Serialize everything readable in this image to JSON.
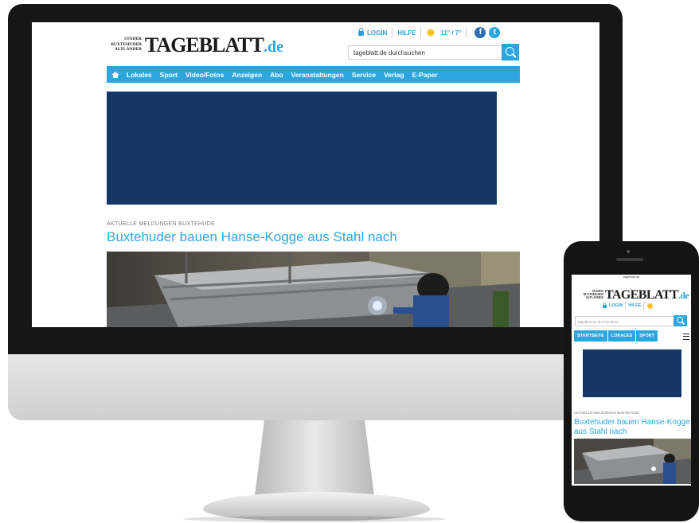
{
  "desktop": {
    "logo": {
      "small_lines": [
        "STADER",
        "BUXTEHUDER",
        "ALTLÄNDER"
      ],
      "main": "TAGEBLATT",
      "tld": ".de"
    },
    "top_links": {
      "login": "LOGIN",
      "help": "HILFE",
      "weather": "11° / 7°"
    },
    "search": {
      "placeholder": "tageblatt.de durchsuchen"
    },
    "nav": [
      "Lokales",
      "Sport",
      "Video/Fotos",
      "Anzeigen",
      "Abo",
      "Veranstaltungen",
      "Service",
      "Verlag",
      "E-Paper"
    ],
    "article": {
      "kicker": "AKTUELLE MELDUNGEN BUXTEHUDE",
      "headline": "Buxtehuder bauen Hanse-Kogge aus Stahl nach"
    }
  },
  "mobile": {
    "status_bar": "tageblatt.de",
    "logo": {
      "small_lines": [
        "STADER",
        "BUXTEHUDER",
        "ALTLÄNDER"
      ],
      "main": "TAGEBLATT",
      "tld": ".de"
    },
    "top_links": {
      "login": "LOGIN",
      "help": "HILFE"
    },
    "search": {
      "placeholder": "tageblatt.de durchsuchen"
    },
    "nav": [
      "STARTSEITE",
      "LOKALES",
      "SPORT"
    ],
    "article": {
      "kicker": "AKTUELLE MELDUNGEN BUXTEHUDE",
      "headline": "Buxtehuder bauen Hanse-Kogge aus Stahl nach"
    }
  },
  "colors": {
    "brand_blue": "#2ba6de",
    "ad_navy": "#163766",
    "monitor_frame": "#161616",
    "chin": "#d9d9d9"
  },
  "icons": [
    "home-icon",
    "lock-icon",
    "sun-icon",
    "facebook-icon",
    "twitter-icon",
    "search-icon",
    "hamburger-menu-icon"
  ]
}
